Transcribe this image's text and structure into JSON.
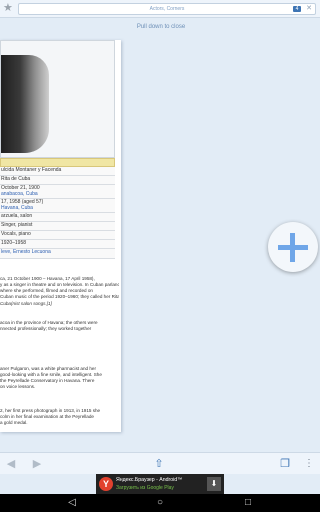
{
  "topbar": {
    "url_text": "Actors, Corners",
    "badge_text": "4"
  },
  "pull_hint": "Pull down to close",
  "article": {
    "infobox_header": "",
    "rows": [
      {
        "label": "",
        "value": "ulcida Montaner y Facenda",
        "link": false
      },
      {
        "label": "",
        "value": "Rita de Cuba",
        "link": false
      },
      {
        "label": "",
        "value": "October 21, 1900",
        "link": false
      },
      {
        "label": "",
        "value": "anabacoa, Cuba",
        "link": true
      },
      {
        "label": "",
        "value": "17, 1958 (aged 57)",
        "link": false
      },
      {
        "label": "",
        "value": "Havana, Cuba",
        "link": true
      },
      {
        "label": "",
        "value": "arzuela, salon",
        "link": false
      },
      {
        "label": "",
        "value": "Singer, pianist",
        "link": false
      },
      {
        "label": "",
        "value": "Vocals, piano",
        "link": false
      },
      {
        "label": "",
        "value": "1920–1958",
        "link": false
      },
      {
        "label": "",
        "value": "leve, Ernesto Lecuona",
        "link": true
      }
    ],
    "paragraphs": [
      "ca, 21 October 1900 – Havana, 17 April 1958),",
      "y as a singer in theatre and on television. In Cuban parlance, she was a vedette (a",
      "where she performed, filmed and recorded on",
      "Cuban music of the period 1920–1960; they called her Rita de",
      "Cuba(nist salon songs.[1]",
      "",
      "acoa in the province of Havana; the others were",
      "nnected professionally; they worked together",
      "",
      "aner Pulgaron, was a white pharmacist and her",
      "good-looking with a fine smile, and intelligent. She",
      "the Peyrellade Conservatory in Havana. There",
      "on voice lessons.",
      "",
      "2, her first press photograph in 1913, in 1915 she",
      "colm in her final examination at the Peyrellade",
      "a gold medal."
    ]
  },
  "icons": {
    "star": "star-icon",
    "back": "back-arrow-icon",
    "forward": "forward-arrow-icon",
    "share": "share-icon",
    "tabs": "tabs-icon",
    "menu": "overflow-menu-icon",
    "add": "plus-icon"
  },
  "ad": {
    "logo": "Y",
    "title": "Яндекс.Браузер - Android™",
    "subtitle": "Загрузить из Google Play",
    "download_label": "⬇"
  },
  "nav": {
    "back": "◁",
    "home": "○",
    "recents": "□"
  },
  "colors": {
    "accent": "#3d74b4",
    "fab_plus": "#6fa6e8",
    "background": "#e2ecf6"
  }
}
